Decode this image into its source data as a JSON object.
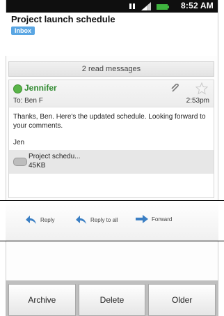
{
  "status_bar": {
    "time": "8:52 AM"
  },
  "header": {
    "subject": "Project launch schedule",
    "label": "Inbox"
  },
  "thread": {
    "read_messages": "2 read messages"
  },
  "message": {
    "sender": "Jennifer",
    "to": "To: Ben F",
    "time": "2:53pm",
    "body": "Thanks, Ben. Here's the updated schedule. Looking forward to your comments.",
    "signature": "Jen",
    "attachment": {
      "name": "Project schedu...",
      "size": "45KB"
    }
  },
  "actions": {
    "reply": "Reply",
    "reply_all": "Reply to all",
    "forward": "Forward"
  },
  "bottom_buttons": {
    "archive": "Archive",
    "delete": "Delete",
    "older": "Older"
  }
}
